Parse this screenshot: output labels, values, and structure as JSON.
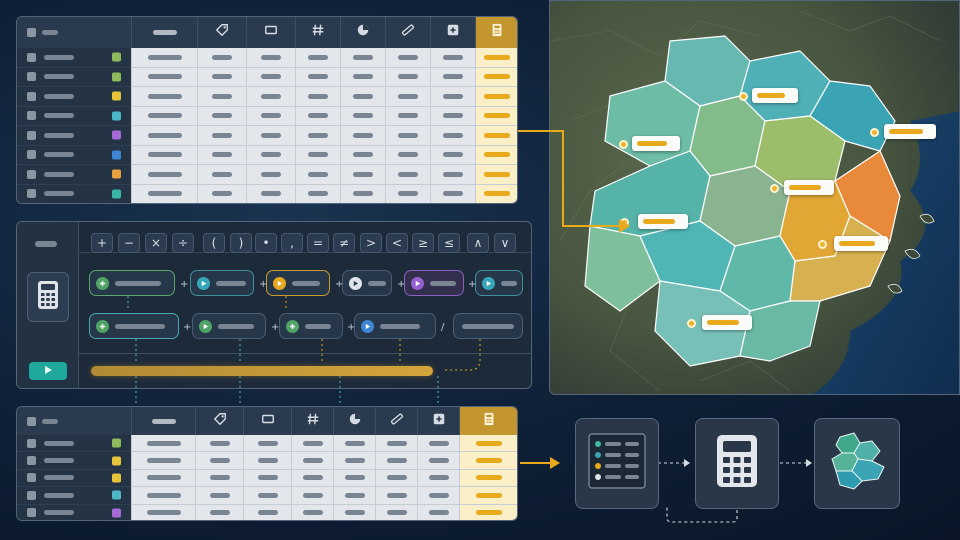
{
  "operators": [
    "+",
    "−",
    "×",
    "÷",
    "(",
    ")",
    "•",
    ",",
    "=",
    "≠",
    ">",
    "<",
    "≥",
    "≤",
    "∧",
    "∨"
  ],
  "pill_separators": [
    "+",
    "+",
    "+",
    "+",
    "+",
    "+",
    "+",
    "+",
    "/"
  ],
  "run_icon": "play-icon",
  "calc_icon": "calculator-icon",
  "colors": {
    "accent_gold": "#e8a91c",
    "panel_bg": "#1f2c3d",
    "table_cell": "#e3e6ea",
    "calc_column": "#fbefc8"
  },
  "column_icons": [
    "text-icon",
    "tag-icon",
    "rectangle-icon",
    "hash-icon",
    "pie-chart-icon",
    "ruler-icon",
    "plus-box-icon",
    "calculator-icon"
  ],
  "top_table_row_colors": [
    "#8fba5b",
    "#8fba5b",
    "#e6c33a",
    "#4bb8c6",
    "#a46ad6",
    "#3e86d4",
    "#e8a13a",
    "#38b7a4"
  ],
  "bottom_table_row_colors": [
    "#8fba5b",
    "#e6c33a",
    "#e6c33a",
    "#4bb8c6",
    "#a46ad6"
  ]
}
